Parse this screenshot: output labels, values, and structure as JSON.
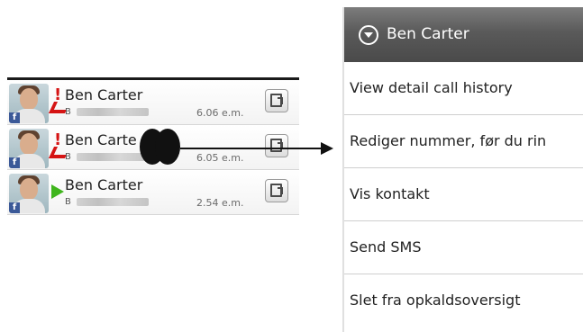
{
  "call_log": {
    "entries": [
      {
        "name": "Ben Carter",
        "type": "B",
        "time": "6.06 e.m.",
        "call_type": "missed"
      },
      {
        "name": "Ben Carte",
        "type": "B",
        "time": "6.05 e.m.",
        "call_type": "missed"
      },
      {
        "name": "Ben Carter",
        "type": "B",
        "time": "2.54 e.m.",
        "call_type": "incoming"
      }
    ],
    "badge_letter": "f"
  },
  "context_menu": {
    "title": "Ben Carter",
    "items": [
      {
        "label": "View detail call history"
      },
      {
        "label": "Rediger nummer, før du rin"
      },
      {
        "label": "Vis kontakt"
      },
      {
        "label": "Send SMS"
      },
      {
        "label": "Slet fra opkaldsoversigt"
      }
    ]
  },
  "colors": {
    "missed": "#d51414",
    "incoming": "#3fb51d",
    "facebook": "#3b5998",
    "menu_header": "#5a5a5a"
  }
}
